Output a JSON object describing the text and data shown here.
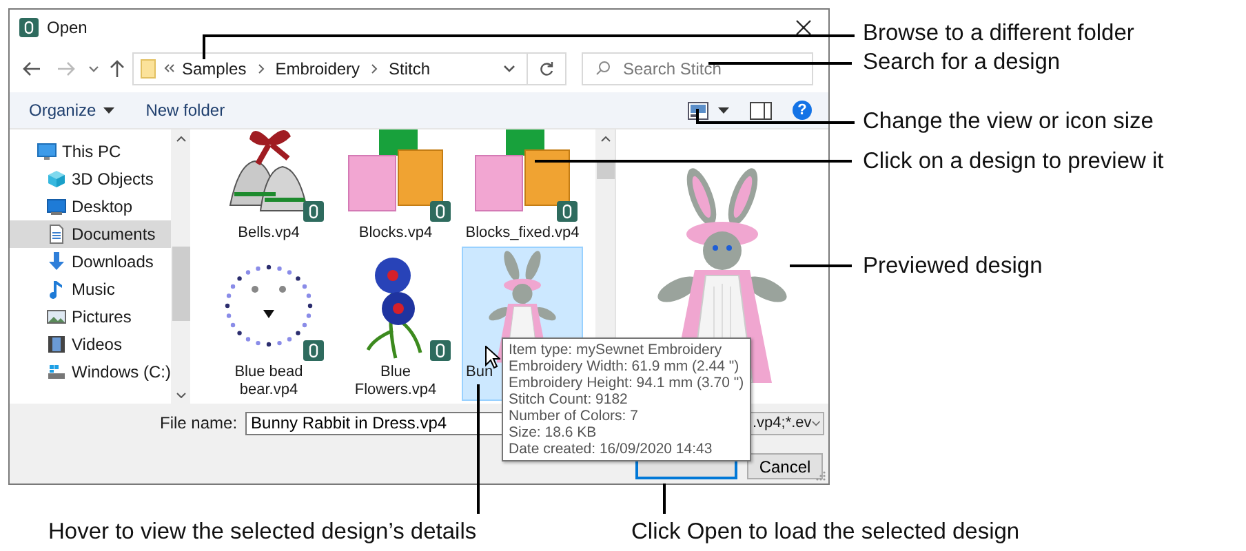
{
  "window": {
    "title": "Open"
  },
  "address_bar": {
    "path": [
      "Samples",
      "Embroidery",
      "Stitch"
    ]
  },
  "search": {
    "placeholder": "Search Stitch"
  },
  "toolbar": {
    "organize": "Organize",
    "new_folder": "New folder",
    "help": "?"
  },
  "sidebar": {
    "items": [
      {
        "label": "This PC",
        "kind": "computer",
        "selected": false,
        "children": [
          {
            "label": "3D Objects",
            "kind": "cube",
            "selected": false
          },
          {
            "label": "Desktop",
            "kind": "desktop",
            "selected": false
          },
          {
            "label": "Documents",
            "kind": "document",
            "selected": true
          },
          {
            "label": "Downloads",
            "kind": "download",
            "selected": false
          },
          {
            "label": "Music",
            "kind": "music",
            "selected": false
          },
          {
            "label": "Pictures",
            "kind": "pictures",
            "selected": false
          },
          {
            "label": "Videos",
            "kind": "videos",
            "selected": false
          },
          {
            "label": "Windows (C:)",
            "kind": "drive",
            "selected": false
          }
        ]
      }
    ]
  },
  "files": [
    {
      "name": "Bells.vp4",
      "kind": "bells",
      "selected": false
    },
    {
      "name": "Blocks.vp4",
      "kind": "blocks",
      "selected": false
    },
    {
      "name": "Blocks_fixed.vp4",
      "kind": "blocks",
      "selected": false
    },
    {
      "name": "Blue bead bear.vp4",
      "kind": "bear",
      "selected": false
    },
    {
      "name": "Blue Flowers.vp4",
      "kind": "flowers",
      "selected": false
    },
    {
      "name": "Bun",
      "kind": "rabbit",
      "selected": true
    }
  ],
  "tooltip": {
    "lines": [
      "Item type: mySewnet Embroidery",
      "Embroidery Width: 61.9 mm (2.44 \")",
      "Embroidery Height: 94.1 mm (3.70 \")",
      "Stitch Count: 9182",
      "Number of Colors: 7",
      "Size: 18.6 KB",
      "Date created: 16/09/2020 14:43"
    ]
  },
  "file_name": {
    "label": "File name:",
    "value": "Bunny Rabbit in Dress.vp4"
  },
  "file_type": {
    "value": ".vp4;*.ev"
  },
  "buttons": {
    "cancel": "Cancel"
  },
  "callouts": [
    {
      "text": "Browse to a different folder"
    },
    {
      "text": "Search for a design"
    },
    {
      "text": "Change the view or icon size"
    },
    {
      "text": "Click on a design to preview it"
    },
    {
      "text": "Previewed design"
    }
  ],
  "captions": [
    {
      "text": "Hover to view the selected design’s details"
    },
    {
      "text": "Click Open to load the selected design"
    }
  ]
}
